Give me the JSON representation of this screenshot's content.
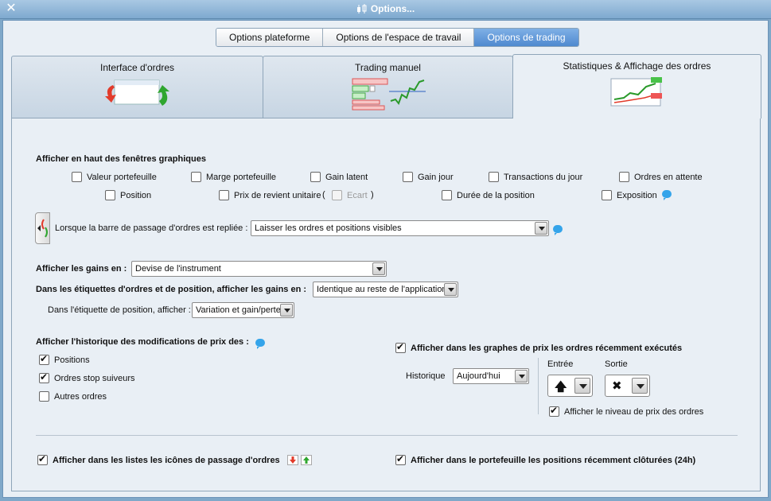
{
  "window": {
    "title": "Options..."
  },
  "top_tabs": [
    {
      "label": "Options plateforme",
      "active": false
    },
    {
      "label": "Options de l'espace de travail",
      "active": false
    },
    {
      "label": "Options de trading",
      "active": true
    }
  ],
  "sub_tabs": [
    {
      "label": "Interface d'ordres",
      "active": false
    },
    {
      "label": "Trading manuel",
      "active": false
    },
    {
      "label": "Statistiques & Affichage des ordres",
      "active": true
    }
  ],
  "graph_section": {
    "heading": "Afficher en haut des fenêtres graphiques",
    "row1": [
      {
        "label": "Valeur portefeuille",
        "checked": false
      },
      {
        "label": "Marge portefeuille",
        "checked": false
      },
      {
        "label": "Gain latent",
        "checked": false
      },
      {
        "label": "Gain jour",
        "checked": false
      },
      {
        "label": "Transactions du jour",
        "checked": false
      },
      {
        "label": "Ordres en attente",
        "checked": false
      }
    ],
    "row2": {
      "position": "Position",
      "unit_cost": "Prix de revient unitaire",
      "open_paren": "(",
      "ecart": "Ecart",
      "close_paren": ")",
      "duration": "Durée de la position",
      "exposure": "Exposition"
    }
  },
  "folded_bar": {
    "label": "Lorsque la barre de passage d'ordres est repliée :",
    "value": "Laisser les ordres et positions visibles"
  },
  "gains": {
    "label": "Afficher les gains en :",
    "value": "Devise de l'instrument",
    "labels_label": "Dans les étiquettes d'ordres et de position, afficher les gains en :",
    "labels_value": "Identique au reste de l'application",
    "position_label": "Dans l'étiquette de position, afficher :",
    "position_value": "Variation et gain/perte"
  },
  "history": {
    "heading": "Afficher l'historique des modifications de prix des :",
    "items": [
      {
        "label": "Positions",
        "checked": true
      },
      {
        "label": "Ordres stop suiveurs",
        "checked": true
      },
      {
        "label": "Autres ordres",
        "checked": false
      }
    ]
  },
  "executed": {
    "label": "Afficher dans les graphes de prix les ordres récemment exécutés",
    "checked": true,
    "history_label": "Historique",
    "history_value": "Aujourd'hui",
    "entry_label": "Entrée",
    "exit_label": "Sortie",
    "price_level_label": "Afficher le niveau de prix des ordres",
    "price_level_checked": true
  },
  "bottom": {
    "list_icons_label": "Afficher dans les listes les icônes de passage d'ordres",
    "list_icons_checked": true,
    "closed_positions_label": "Afficher dans le portefeuille les positions récemment clôturées (24h)",
    "closed_positions_checked": true
  },
  "colors": {
    "accent": "#4f89cf",
    "title_bg": "#7ea9cf",
    "info": "#34a4ea"
  }
}
